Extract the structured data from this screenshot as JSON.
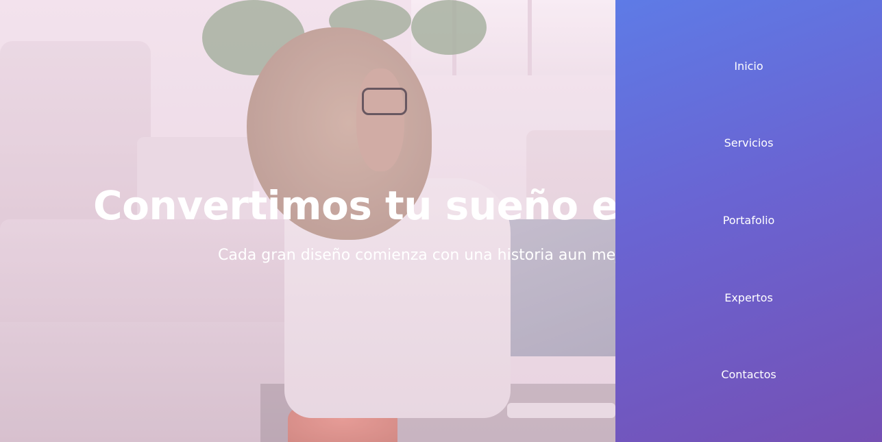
{
  "hero": {
    "title": "Convertimos tu sueño en realidad",
    "subtitle": "Cada gran diseño comienza con una historia aun mejor"
  },
  "nav": {
    "items": [
      {
        "label": "Inicio"
      },
      {
        "label": "Servicios"
      },
      {
        "label": "Portafolio"
      },
      {
        "label": "Expertos"
      },
      {
        "label": "Contactos"
      }
    ]
  },
  "colors": {
    "nav_gradient_start": "#5e7be6",
    "nav_gradient_end": "#7550b4",
    "hero_text": "#ffffff"
  }
}
